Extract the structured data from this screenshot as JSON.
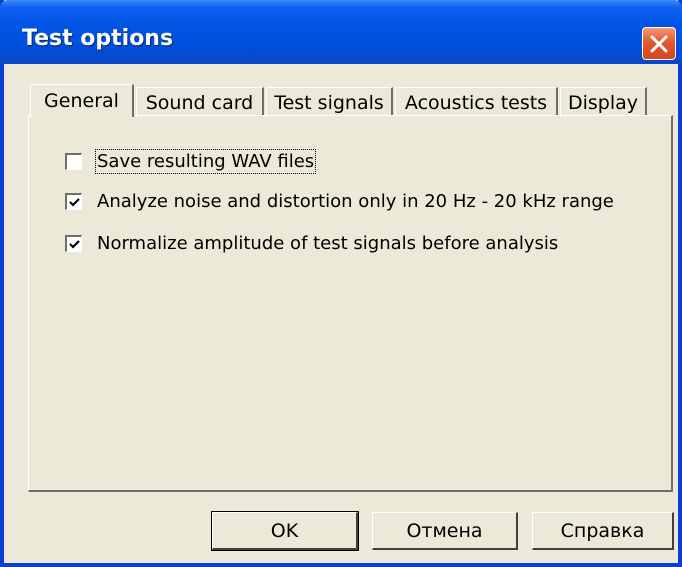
{
  "window": {
    "title": "Test options"
  },
  "tabs": [
    {
      "label": "General",
      "active": true
    },
    {
      "label": "Sound card",
      "active": false
    },
    {
      "label": "Test signals",
      "active": false
    },
    {
      "label": "Acoustics tests",
      "active": false
    },
    {
      "label": "Display",
      "active": false
    }
  ],
  "options": [
    {
      "label": "Save resulting WAV files",
      "checked": false
    },
    {
      "label": "Analyze noise and distortion only in 20 Hz - 20 kHz range",
      "checked": true
    },
    {
      "label": "Normalize amplitude of test signals before analysis",
      "checked": true
    }
  ],
  "buttons": {
    "ok": "OK",
    "cancel": "Отмена",
    "help": "Справка"
  },
  "colors": {
    "titlebar": "#0054e3",
    "dialog_bg": "#ece9d8",
    "close_button": "#e2582f"
  }
}
